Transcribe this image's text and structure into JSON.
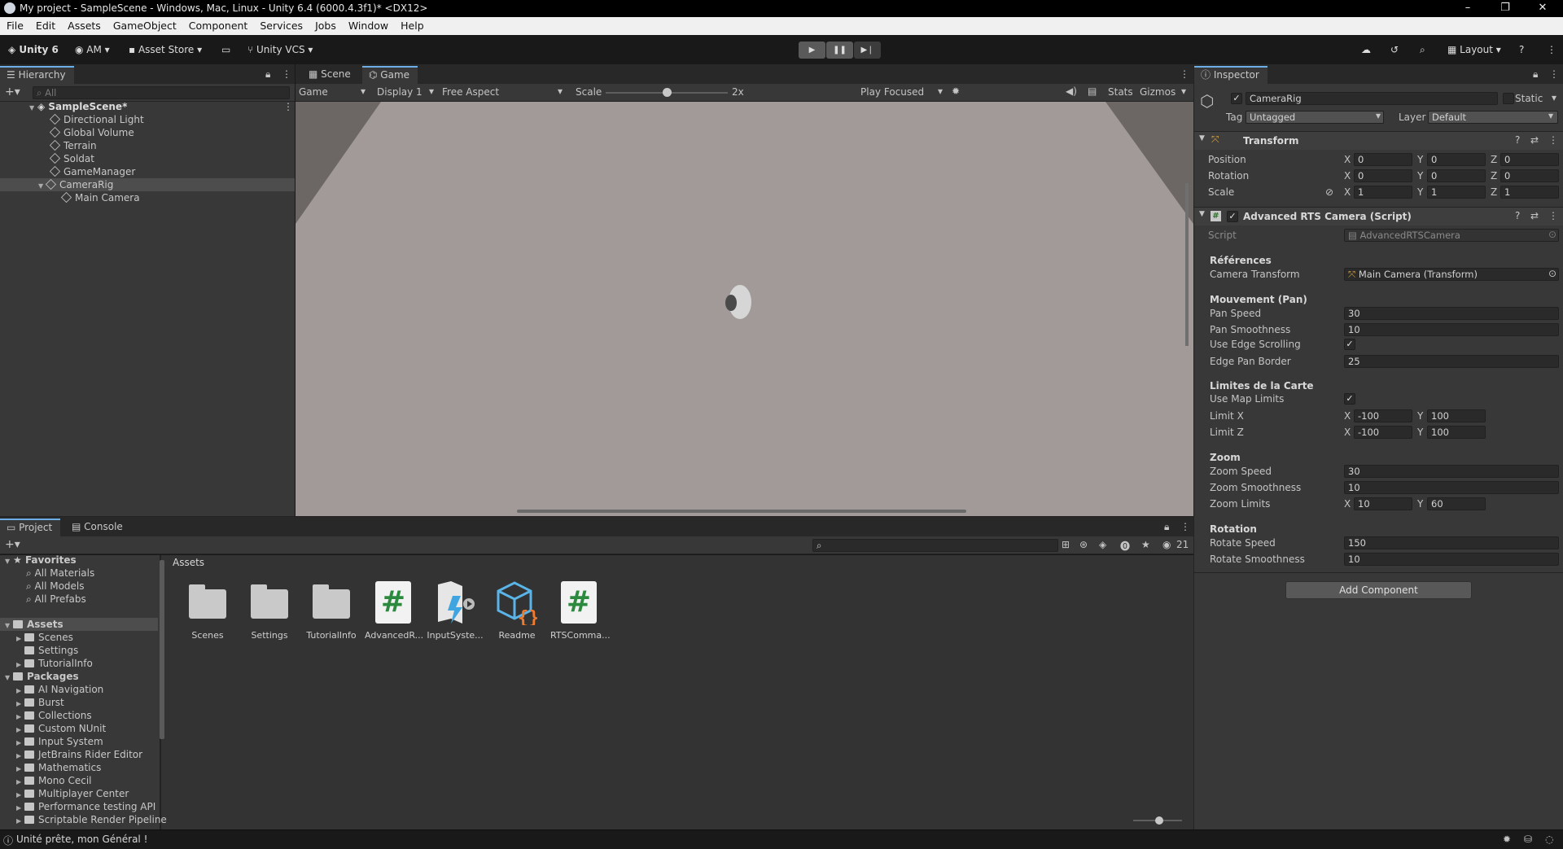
{
  "window": {
    "title": "My project - SampleScene - Windows, Mac, Linux - Unity 6.4 (6000.4.3f1)* <DX12>",
    "controls": [
      "–",
      "❐",
      "✕"
    ]
  },
  "menu": [
    "File",
    "Edit",
    "Assets",
    "GameObject",
    "Component",
    "Services",
    "Jobs",
    "Window",
    "Help"
  ],
  "toolbar": {
    "unity_label": "Unity 6",
    "account": "AM",
    "asset_store": "Asset Store",
    "vcs": "Unity VCS",
    "layout": "Layout"
  },
  "hierarchy": {
    "tab": "Hierarchy",
    "search_placeholder": "All",
    "scene": "SampleScene*",
    "items": [
      "Directional Light",
      "Global Volume",
      "Terrain",
      "Soldat",
      "GameManager",
      "CameraRig"
    ],
    "child": "Main Camera"
  },
  "game": {
    "tab_scene": "Scene",
    "tab_game": "Game",
    "mode": "Game",
    "display": "Display 1",
    "aspect": "Free Aspect",
    "scale_label": "Scale",
    "scale_value": "2x",
    "play_focus": "Play Focused",
    "stats": "Stats",
    "gizmos": "Gizmos",
    "scale_slider": 0.5
  },
  "inspector": {
    "tab": "Inspector",
    "object_name": "CameraRig",
    "static_label": "Static",
    "tag_label": "Tag",
    "tag_value": "Untagged",
    "layer_label": "Layer",
    "layer_value": "Default",
    "transform": {
      "title": "Transform",
      "position_label": "Position",
      "rotation_label": "Rotation",
      "scale_label": "Scale",
      "position": [
        "0",
        "0",
        "0"
      ],
      "rotation": [
        "0",
        "0",
        "0"
      ],
      "scale": [
        "1",
        "1",
        "1"
      ]
    },
    "script_comp": {
      "title": "Advanced RTS Camera (Script)",
      "script_label": "Script",
      "script_value": "AdvancedRTSCamera",
      "sec_refs": "Références",
      "cam_transform_label": "Camera Transform",
      "cam_transform_value": "Main Camera (Transform)",
      "sec_pan": "Mouvement (Pan)",
      "pan_speed_label": "Pan Speed",
      "pan_speed": "30",
      "pan_smooth_label": "Pan Smoothness",
      "pan_smooth": "10",
      "edge_scroll_label": "Use Edge Scrolling",
      "edge_border_label": "Edge Pan Border",
      "edge_border": "25",
      "sec_limits": "Limites de la Carte",
      "map_limits_label": "Use Map Limits",
      "limit_x_label": "Limit X",
      "limit_x": [
        "-100",
        "100"
      ],
      "limit_z_label": "Limit Z",
      "limit_z": [
        "-100",
        "100"
      ],
      "sec_zoom": "Zoom",
      "zoom_speed_label": "Zoom Speed",
      "zoom_speed": "30",
      "zoom_smooth_label": "Zoom Smoothness",
      "zoom_smooth": "10",
      "zoom_limits_label": "Zoom Limits",
      "zoom_limits": [
        "10",
        "60"
      ],
      "sec_rotation": "Rotation",
      "rotate_speed_label": "Rotate Speed",
      "rotate_speed": "150",
      "rotate_smooth_label": "Rotate Smoothness",
      "rotate_smooth": "10"
    },
    "add_component": "Add Component"
  },
  "project": {
    "tab_project": "Project",
    "tab_console": "Console",
    "hidden_count": "21",
    "favorites_label": "Favorites",
    "favorites": [
      "All Materials",
      "All Models",
      "All Prefabs"
    ],
    "assets_label": "Assets",
    "asset_folders": [
      "Scenes",
      "Settings",
      "TutorialInfo"
    ],
    "packages_label": "Packages",
    "packages": [
      "AI Navigation",
      "Burst",
      "Collections",
      "Custom NUnit",
      "Input System",
      "JetBrains Rider Editor",
      "Mathematics",
      "Mono Cecil",
      "Multiplayer Center",
      "Performance testing API",
      "Scriptable Render Pipeline"
    ],
    "breadcrumb": "Assets",
    "grid": [
      "Scenes",
      "Settings",
      "TutorialInfo",
      "AdvancedR...",
      "InputSyste...",
      "Readme",
      "RTSComma..."
    ]
  },
  "status": {
    "message": "Unité prête, mon Général !"
  }
}
